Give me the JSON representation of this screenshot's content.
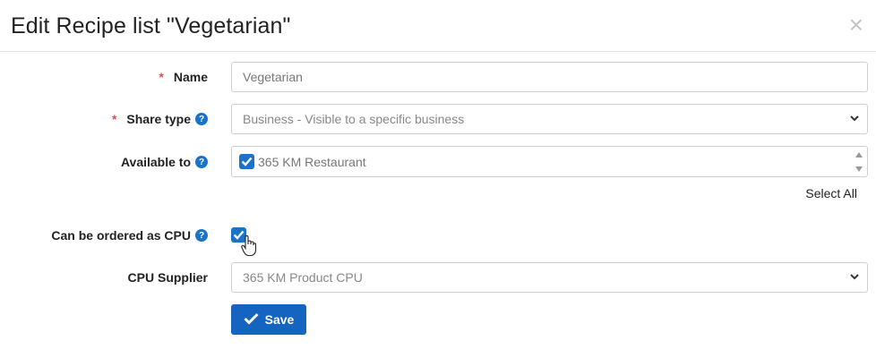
{
  "dialog": {
    "title": "Edit Recipe list \"Vegetarian\"",
    "close_icon": "close-icon"
  },
  "form": {
    "name": {
      "label": "Name",
      "required_mark": "*",
      "value": "Vegetarian"
    },
    "share_type": {
      "label": "Share type",
      "required_mark": "*",
      "help_icon": "question-circle-icon",
      "value": "Business - Visible to a specific business"
    },
    "available_to": {
      "label": "Available to",
      "help_icon": "question-circle-icon",
      "items": [
        {
          "label": "365 KM Restaurant",
          "checked": true
        }
      ],
      "select_all": "Select All"
    },
    "cpu_orderable": {
      "label": "Can be ordered as CPU",
      "help_icon": "question-circle-icon",
      "checked": true
    },
    "cpu_supplier": {
      "label": "CPU Supplier",
      "value": "365 KM Product CPU"
    },
    "save_button": {
      "label": "Save",
      "icon": "checkmark-icon"
    }
  },
  "colors": {
    "accent": "#1a73c9",
    "save_bg": "#1565c0",
    "required": "#d9534f"
  }
}
